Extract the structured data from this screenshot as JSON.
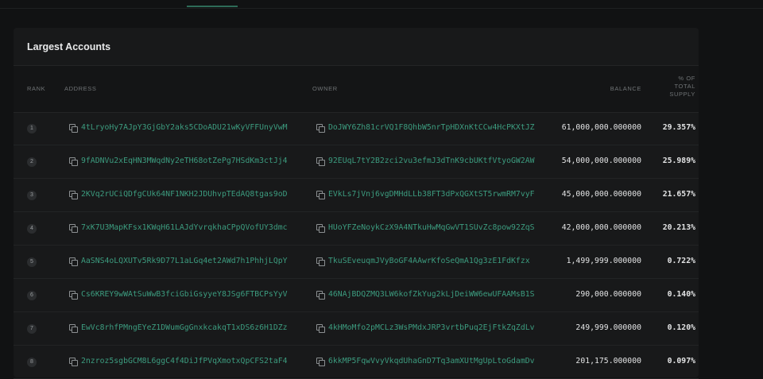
{
  "panel": {
    "title": "Largest Accounts"
  },
  "columns": {
    "rank": "RANK",
    "address": "ADDRESS",
    "owner": "OWNER",
    "balance": "BALANCE",
    "pct_line1": "% OF",
    "pct_line2": "TOTAL",
    "pct_line3": "SUPPLY"
  },
  "rows": [
    {
      "rank": "1",
      "address": "4tLryoHy7AJpY3GjGbY2aks5CDoADU21wKyVFFUnyVwM",
      "owner": "DoJWY6Zh81crVQ1F8QhbW5nrTpHDXnKtCCw4HcPKXtJZ",
      "balance": "61,000,000.000000",
      "pct": "29.357%"
    },
    {
      "rank": "2",
      "address": "9fADNVu2xEqHN3MWqdNy2eTH68otZePg7HSdKm3ctJj4",
      "owner": "92EUqL7tY2B2zci2vu3efmJ3dTnK9cbUKtfVtyoGW2AW",
      "balance": "54,000,000.000000",
      "pct": "25.989%"
    },
    {
      "rank": "3",
      "address": "2KVq2rUCiQDfgCUk64NF1NKH2JDUhvpTEdAQ8tgas9oD",
      "owner": "EVkLs7jVnj6vgDMHdLLb38FT3dPxQGXtST5rwmRM7vyF",
      "balance": "45,000,000.000000",
      "pct": "21.657%"
    },
    {
      "rank": "4",
      "address": "7xK7U3MapKFsx1KWqH61LAJdYvrqkhaCPpQVofUY3dmc",
      "owner": "HUoYFZeNoykCzX9A4NTkuHwMqGwVT1SUvZc8pow92ZqS",
      "balance": "42,000,000.000000",
      "pct": "20.213%"
    },
    {
      "rank": "5",
      "address": "AaSNS4oLQXUTv5Rk9D77L1aLGq4et2AWd7h1PhhjLQpY",
      "owner": "TkuSEveuqmJVyBoGF4AAwrKfoSeQmA1Qg3zE1FdKfzx",
      "balance": "1,499,999.000000",
      "pct": "0.722%"
    },
    {
      "rank": "6",
      "address": "Cs6KREY9wWAtSuWwB3fciGbiGsyyeY8JSg6FTBCPsYyV",
      "owner": "46NAjBDQZMQ3LW6kofZkYug2kLjDeiWW6ewUFAAMsB1S",
      "balance": "290,000.000000",
      "pct": "0.140%"
    },
    {
      "rank": "7",
      "address": "EwVc8rhfPMngEYeZ1DWumGgGnxkcakqT1xDS6z6H1DZz",
      "owner": "4kHMoMfo2pMCLz3WsPMdxJRP3vrtbPuq2EjFtkZqZdLv",
      "balance": "249,999.000000",
      "pct": "0.120%"
    },
    {
      "rank": "8",
      "address": "2nzroz5sgbGCM8L6ggC4f4DiJfPVqXmotxQpCFS2taF4",
      "owner": "6kkMP5FqwVvyVkqdUhaGnD7Tq3amXUtMgUpLtoGdamDv",
      "balance": "201,175.000000",
      "pct": "0.097%"
    }
  ]
}
